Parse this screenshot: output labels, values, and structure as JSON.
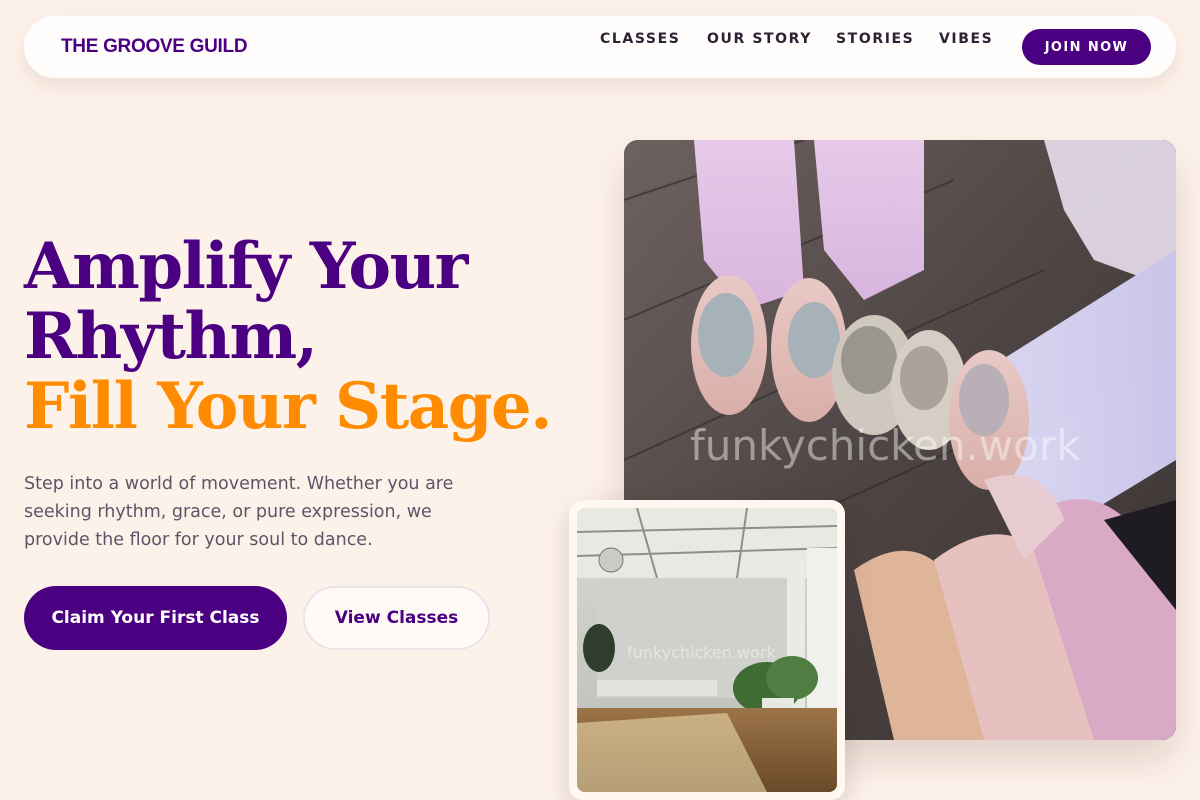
{
  "brand": {
    "name": "THE GROOVE GUILD",
    "color": "#4b0082"
  },
  "nav": {
    "items": [
      {
        "label": "CLASSES"
      },
      {
        "label": "OUR STORY"
      },
      {
        "label": "STORIES"
      },
      {
        "label": "VIBES"
      }
    ],
    "cta_label": "JOIN NOW"
  },
  "hero": {
    "title_line1": "Amplify Your",
    "title_line2": "Rhythm,",
    "title_line3": "Fill Your Stage.",
    "subtitle": "Step into a world of movement. Whether you are seeking rhythm, grace, or pure expression, we provide the floor for your soul to dance.",
    "primary_cta": "Claim Your First Class",
    "secondary_cta": "View Classes"
  },
  "images": {
    "main_watermark": "funkychicken.work",
    "studio_watermark": "funkychicken.work",
    "main_icon": "ballet-shoes-photo",
    "studio_icon": "dance-studio-photo"
  },
  "colors": {
    "accent_purple": "#4b0082",
    "accent_orange": "#ff8c00",
    "background": "#fdf2ea"
  }
}
